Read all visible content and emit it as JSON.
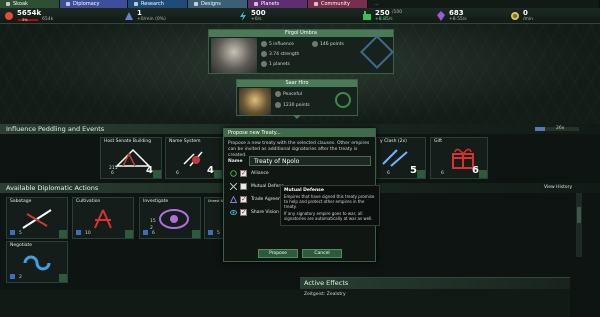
{
  "tabs": [
    {
      "label": "Skoak"
    },
    {
      "label": "Diplomacy"
    },
    {
      "label": "Research"
    },
    {
      "label": "Designs"
    },
    {
      "label": "Planets"
    },
    {
      "label": "Community"
    },
    {
      "label": "..."
    }
  ],
  "resources": {
    "skoak": {
      "value": "5654k",
      "sub": "654k",
      "bar": "3%",
      "color": "#e34b3b"
    },
    "influence": {
      "value": "1",
      "sub": "+0/min (0%)",
      "color": "#6b7fd8"
    },
    "research": {
      "value": "500",
      "sub": "+0/s",
      "color": "#3fb2c9"
    },
    "industry": {
      "value": "250",
      "sub": "+8.85/s",
      "sub2": "/100",
      "color": "#3bbf55"
    },
    "food": {
      "value": "683",
      "sub": "+8.55/s",
      "color": "#9a5bd8"
    },
    "money": {
      "value": "0",
      "sub": "/min",
      "color": "#d8c35b"
    }
  },
  "leader_primary": {
    "name": "Firgol Umbra",
    "influence": "5 influence",
    "points": "146 points",
    "strength": "3.74 strength",
    "planets": "1 planets"
  },
  "leader_secondary": {
    "name": "Saar Hiro",
    "status": "Peaceful",
    "points": "1230 points"
  },
  "influence_section": {
    "title": "Influence Peddling and Events",
    "scroll_value": "26x",
    "cards": [
      {
        "title": "Host Senate Building",
        "number": "4",
        "bottom": "6",
        "extra": "215"
      },
      {
        "title": "Name System",
        "number": "4",
        "bottom": "6"
      },
      {
        "title": "y Clash (2x)",
        "number": "5",
        "bottom": "6"
      },
      {
        "title": "Gift",
        "number": "6",
        "bottom": "6"
      }
    ]
  },
  "diplo_section": {
    "title": "Available Diplomatic Actions",
    "view_history": "View History",
    "actions": [
      {
        "title": "Sabotage",
        "number": "5"
      },
      {
        "title": "Cultivation",
        "number": "10"
      },
      {
        "title": "Investigate",
        "number": "6",
        "extra1": "15",
        "extra2": "2"
      },
      {
        "title": "Unrest Ne",
        "number": "5"
      },
      {
        "title": "Negotiate",
        "number": "2"
      }
    ]
  },
  "dialog": {
    "title": "Propose new Treaty...",
    "description": "Propose a new treaty with the selected clauses. Other empires can be invited as additional signatories after the treaty is created.",
    "name_label": "Name",
    "name_value": "Treaty of Npolo",
    "clauses": [
      {
        "label": "Alliance",
        "checked": true
      },
      {
        "label": "Mutual Defens",
        "checked": false
      },
      {
        "label": "Trade Agreem",
        "checked": true
      },
      {
        "label": "Share Vision",
        "checked": true
      }
    ],
    "propose_label": "Propose",
    "cancel_label": "Cancel"
  },
  "tooltip": {
    "title": "Mutual Defense",
    "text1": "Empires that have signed this treaty promise to help and protect other empires in the treaty.",
    "text2": "If any signatory empire goes to war, all signatories are automatically at war as well."
  },
  "active_effects": {
    "title": "Active Effects",
    "items": [
      "Zeitgeist: Zealotry"
    ]
  }
}
